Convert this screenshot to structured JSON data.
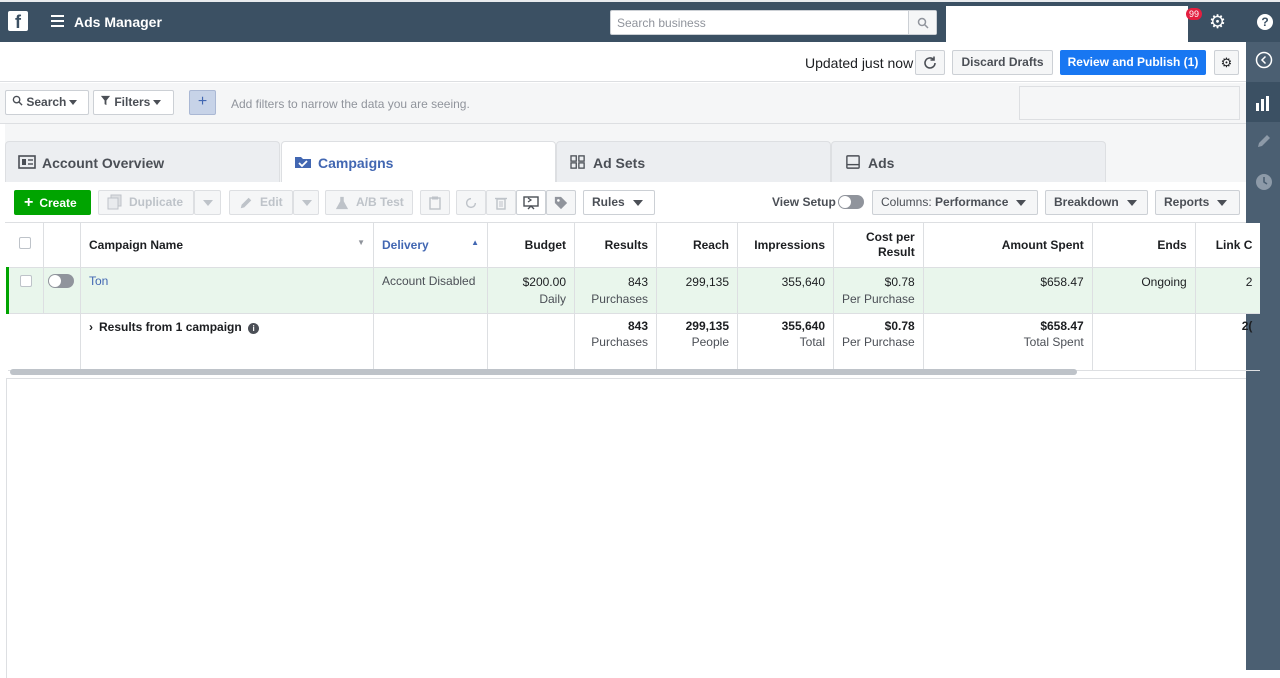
{
  "topbar": {
    "logo": "f",
    "title": "Ads Manager",
    "search_placeholder": "Search business",
    "notification_count": "99"
  },
  "actionbar": {
    "updated": "Updated just now",
    "discard": "Discard Drafts",
    "publish": "Review and Publish (1)"
  },
  "filterbar": {
    "search": "Search",
    "filters": "Filters",
    "plus": "+",
    "hint": "Add filters to narrow the data you are seeing."
  },
  "tabs": [
    {
      "label": "Account Overview"
    },
    {
      "label": "Campaigns"
    },
    {
      "label": "Ad Sets"
    },
    {
      "label": "Ads"
    }
  ],
  "toolbar": {
    "create": "Create",
    "duplicate": "Duplicate",
    "edit": "Edit",
    "ab_test": "A/B Test",
    "rules": "Rules",
    "view_setup": "View Setup",
    "columns_prefix": "Columns:",
    "columns_value": "Performance",
    "breakdown": "Breakdown",
    "reports": "Reports"
  },
  "table": {
    "headers": {
      "campaign_name": "Campaign Name",
      "delivery": "Delivery",
      "budget": "Budget",
      "results": "Results",
      "reach": "Reach",
      "impressions": "Impressions",
      "cost_per_result_1": "Cost per",
      "cost_per_result_2": "Result",
      "amount_spent": "Amount Spent",
      "ends": "Ends",
      "link": "Link C"
    },
    "row": {
      "name": "Ton",
      "delivery": "Account Disabled",
      "budget": "$200.00",
      "budget_sub": "Daily",
      "results": "843",
      "results_sub": "Purchases",
      "reach": "299,135",
      "impressions": "355,640",
      "cost": "$0.78",
      "cost_sub": "Per Purchase",
      "spent": "$658.47",
      "ends": "Ongoing",
      "link": "2"
    },
    "total": {
      "label": "Results from 1 campaign",
      "results": "843",
      "results_sub": "Purchases",
      "reach": "299,135",
      "reach_sub": "People",
      "impressions": "355,640",
      "impressions_sub": "Total",
      "cost": "$0.78",
      "cost_sub": "Per Purchase",
      "spent": "$658.47",
      "spent_sub": "Total Spent",
      "link": "2("
    }
  }
}
